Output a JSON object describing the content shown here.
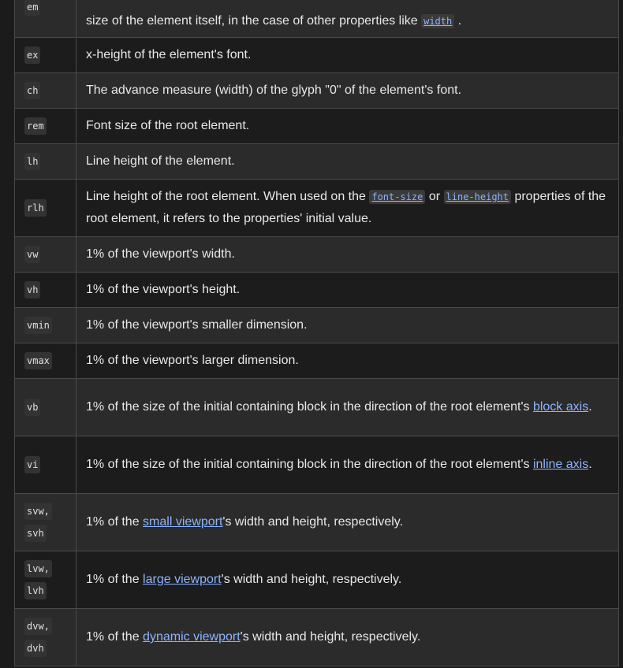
{
  "rows": [
    {
      "unit": "em",
      "desc_pre": "size of the element itself, in the case of other properties like ",
      "code_link": "width",
      "desc_post": " ."
    },
    {
      "unit": "ex",
      "desc": "x-height of the element's font."
    },
    {
      "unit": "ch",
      "desc": "The advance measure (width) of the glyph \"0\" of the element's font."
    },
    {
      "unit": "rem",
      "desc": "Font size of the root element."
    },
    {
      "unit": "lh",
      "desc": "Line height of the element."
    },
    {
      "unit": "rlh",
      "desc_a": "Line height of the root element. When used on the ",
      "code_a": "font-size",
      "desc_b": " or ",
      "code_b": "line-height",
      "desc_c": " properties of the root element, it refers to the properties' initial value."
    },
    {
      "unit": "vw",
      "desc": "1% of the viewport's width."
    },
    {
      "unit": "vh",
      "desc": "1% of the viewport's height."
    },
    {
      "unit": "vmin",
      "desc": "1% of the viewport's smaller dimension."
    },
    {
      "unit": "vmax",
      "desc": "1% of the viewport's larger dimension."
    },
    {
      "unit": "vb",
      "desc_pre": "1% of the size of the initial containing block in the direction of the root element's ",
      "link": "block axis",
      "desc_post": "."
    },
    {
      "unit": "vi",
      "desc_pre": "1% of the size of the initial containing block in the direction of the root element's ",
      "link": "inline axis",
      "desc_post": "."
    },
    {
      "unit_a": "svw,",
      "unit_b": "svh",
      "desc_pre": "1% of the ",
      "link": "small viewport",
      "desc_post": "'s width and height, respectively."
    },
    {
      "unit_a": "lvw,",
      "unit_b": "lvh",
      "desc_pre": "1% of the ",
      "link": "large viewport",
      "desc_post": "'s width and height, respectively."
    },
    {
      "unit_a": "dvw,",
      "unit_b": "dvh",
      "desc_pre": "1% of the ",
      "link": "dynamic viewport",
      "desc_post": "'s width and height, respectively."
    }
  ]
}
